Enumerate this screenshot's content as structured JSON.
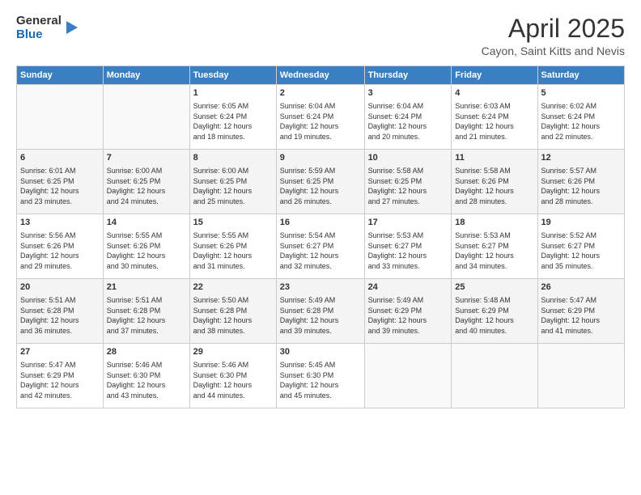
{
  "logo": {
    "general": "General",
    "blue": "Blue"
  },
  "header": {
    "month": "April 2025",
    "location": "Cayon, Saint Kitts and Nevis"
  },
  "days_of_week": [
    "Sunday",
    "Monday",
    "Tuesday",
    "Wednesday",
    "Thursday",
    "Friday",
    "Saturday"
  ],
  "weeks": [
    [
      {
        "day": "",
        "info": ""
      },
      {
        "day": "",
        "info": ""
      },
      {
        "day": "1",
        "info": "Sunrise: 6:05 AM\nSunset: 6:24 PM\nDaylight: 12 hours\nand 18 minutes."
      },
      {
        "day": "2",
        "info": "Sunrise: 6:04 AM\nSunset: 6:24 PM\nDaylight: 12 hours\nand 19 minutes."
      },
      {
        "day": "3",
        "info": "Sunrise: 6:04 AM\nSunset: 6:24 PM\nDaylight: 12 hours\nand 20 minutes."
      },
      {
        "day": "4",
        "info": "Sunrise: 6:03 AM\nSunset: 6:24 PM\nDaylight: 12 hours\nand 21 minutes."
      },
      {
        "day": "5",
        "info": "Sunrise: 6:02 AM\nSunset: 6:24 PM\nDaylight: 12 hours\nand 22 minutes."
      }
    ],
    [
      {
        "day": "6",
        "info": "Sunrise: 6:01 AM\nSunset: 6:25 PM\nDaylight: 12 hours\nand 23 minutes."
      },
      {
        "day": "7",
        "info": "Sunrise: 6:00 AM\nSunset: 6:25 PM\nDaylight: 12 hours\nand 24 minutes."
      },
      {
        "day": "8",
        "info": "Sunrise: 6:00 AM\nSunset: 6:25 PM\nDaylight: 12 hours\nand 25 minutes."
      },
      {
        "day": "9",
        "info": "Sunrise: 5:59 AM\nSunset: 6:25 PM\nDaylight: 12 hours\nand 26 minutes."
      },
      {
        "day": "10",
        "info": "Sunrise: 5:58 AM\nSunset: 6:25 PM\nDaylight: 12 hours\nand 27 minutes."
      },
      {
        "day": "11",
        "info": "Sunrise: 5:58 AM\nSunset: 6:26 PM\nDaylight: 12 hours\nand 28 minutes."
      },
      {
        "day": "12",
        "info": "Sunrise: 5:57 AM\nSunset: 6:26 PM\nDaylight: 12 hours\nand 28 minutes."
      }
    ],
    [
      {
        "day": "13",
        "info": "Sunrise: 5:56 AM\nSunset: 6:26 PM\nDaylight: 12 hours\nand 29 minutes."
      },
      {
        "day": "14",
        "info": "Sunrise: 5:55 AM\nSunset: 6:26 PM\nDaylight: 12 hours\nand 30 minutes."
      },
      {
        "day": "15",
        "info": "Sunrise: 5:55 AM\nSunset: 6:26 PM\nDaylight: 12 hours\nand 31 minutes."
      },
      {
        "day": "16",
        "info": "Sunrise: 5:54 AM\nSunset: 6:27 PM\nDaylight: 12 hours\nand 32 minutes."
      },
      {
        "day": "17",
        "info": "Sunrise: 5:53 AM\nSunset: 6:27 PM\nDaylight: 12 hours\nand 33 minutes."
      },
      {
        "day": "18",
        "info": "Sunrise: 5:53 AM\nSunset: 6:27 PM\nDaylight: 12 hours\nand 34 minutes."
      },
      {
        "day": "19",
        "info": "Sunrise: 5:52 AM\nSunset: 6:27 PM\nDaylight: 12 hours\nand 35 minutes."
      }
    ],
    [
      {
        "day": "20",
        "info": "Sunrise: 5:51 AM\nSunset: 6:28 PM\nDaylight: 12 hours\nand 36 minutes."
      },
      {
        "day": "21",
        "info": "Sunrise: 5:51 AM\nSunset: 6:28 PM\nDaylight: 12 hours\nand 37 minutes."
      },
      {
        "day": "22",
        "info": "Sunrise: 5:50 AM\nSunset: 6:28 PM\nDaylight: 12 hours\nand 38 minutes."
      },
      {
        "day": "23",
        "info": "Sunrise: 5:49 AM\nSunset: 6:28 PM\nDaylight: 12 hours\nand 39 minutes."
      },
      {
        "day": "24",
        "info": "Sunrise: 5:49 AM\nSunset: 6:29 PM\nDaylight: 12 hours\nand 39 minutes."
      },
      {
        "day": "25",
        "info": "Sunrise: 5:48 AM\nSunset: 6:29 PM\nDaylight: 12 hours\nand 40 minutes."
      },
      {
        "day": "26",
        "info": "Sunrise: 5:47 AM\nSunset: 6:29 PM\nDaylight: 12 hours\nand 41 minutes."
      }
    ],
    [
      {
        "day": "27",
        "info": "Sunrise: 5:47 AM\nSunset: 6:29 PM\nDaylight: 12 hours\nand 42 minutes."
      },
      {
        "day": "28",
        "info": "Sunrise: 5:46 AM\nSunset: 6:30 PM\nDaylight: 12 hours\nand 43 minutes."
      },
      {
        "day": "29",
        "info": "Sunrise: 5:46 AM\nSunset: 6:30 PM\nDaylight: 12 hours\nand 44 minutes."
      },
      {
        "day": "30",
        "info": "Sunrise: 5:45 AM\nSunset: 6:30 PM\nDaylight: 12 hours\nand 45 minutes."
      },
      {
        "day": "",
        "info": ""
      },
      {
        "day": "",
        "info": ""
      },
      {
        "day": "",
        "info": ""
      }
    ]
  ]
}
